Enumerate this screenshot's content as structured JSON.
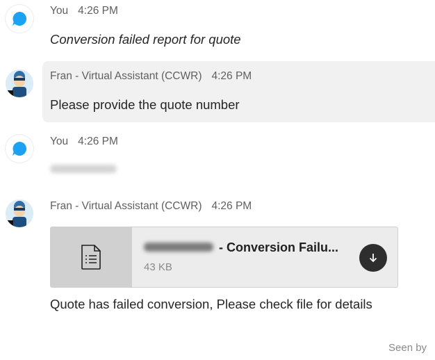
{
  "messages": [
    {
      "sender": "You",
      "time": "4:26 PM",
      "text": "Conversion failed report for quote"
    },
    {
      "sender": "Fran - Virtual Assistant (CCWR)",
      "time": "4:26 PM",
      "text": "Please provide the quote number"
    },
    {
      "sender": "You",
      "time": "4:26 PM",
      "text": ""
    },
    {
      "sender": "Fran - Virtual Assistant (CCWR)",
      "time": "4:26 PM",
      "attachment": {
        "name": "- Conversion Failu...",
        "size": "43 KB"
      },
      "text": "Quote has failed conversion, Please check file for details"
    }
  ],
  "status": {
    "seen": "Seen by"
  },
  "colors": {
    "accent": "#1DA1F2",
    "bubble": "#f1f1f1"
  },
  "icons": {
    "you_avatar": "chat-bubble-icon",
    "bot_avatar": "robot-avatar",
    "file": "document-icon",
    "download": "download-arrow-icon"
  }
}
